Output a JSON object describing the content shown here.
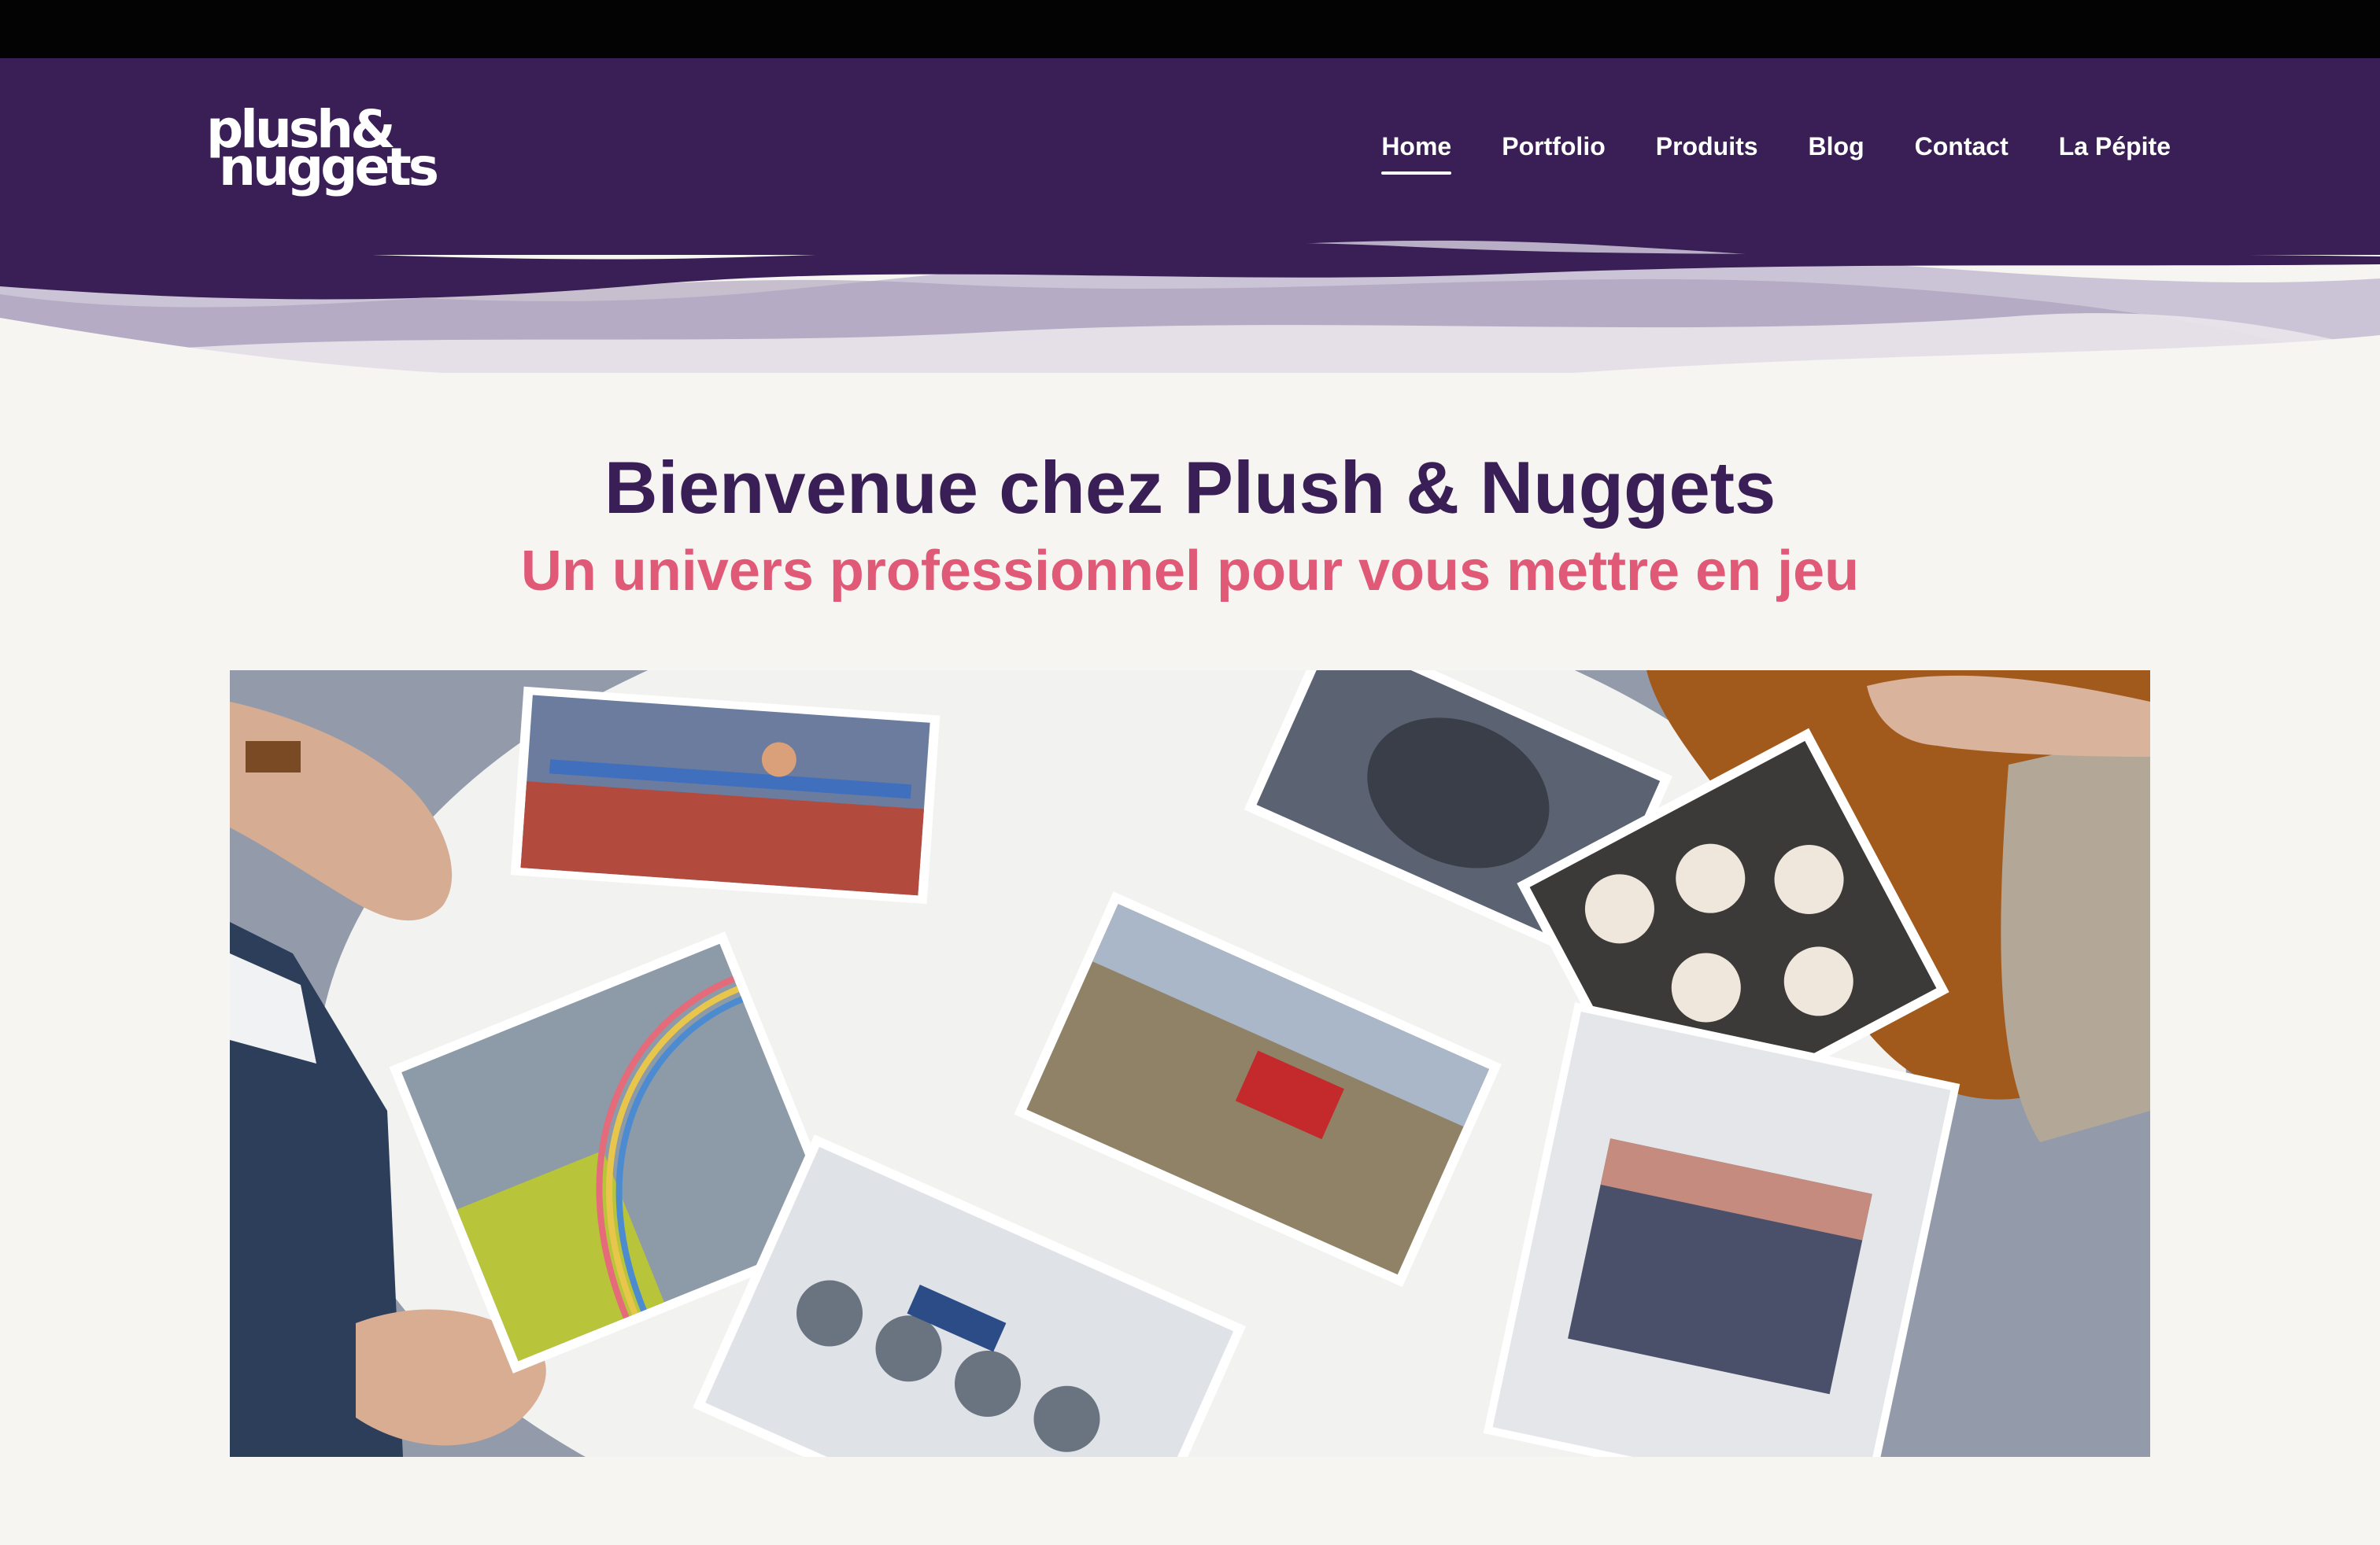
{
  "header": {
    "logo": {
      "line1": "plush&",
      "line2": "nuggets"
    },
    "nav": [
      {
        "label": "Home",
        "active": true
      },
      {
        "label": "Portfolio",
        "active": false
      },
      {
        "label": "Produits",
        "active": false
      },
      {
        "label": "Blog",
        "active": false
      },
      {
        "label": "Contact",
        "active": false
      },
      {
        "label": "La Pépite",
        "active": false
      }
    ]
  },
  "hero": {
    "title": "Bienvenue chez Plush & Nuggets",
    "subtitle": "Un univers professionnel pour vous mettre en jeu",
    "image_icon": "photo-prints-on-table-image"
  },
  "colors": {
    "header_purple": "#3a1f56",
    "wave_light": "#d9d2e1",
    "page_background": "#f6f5f1",
    "title_purple": "#3a1f56",
    "subtitle_pink": "#e05a78",
    "nav_text": "#ffffff"
  }
}
